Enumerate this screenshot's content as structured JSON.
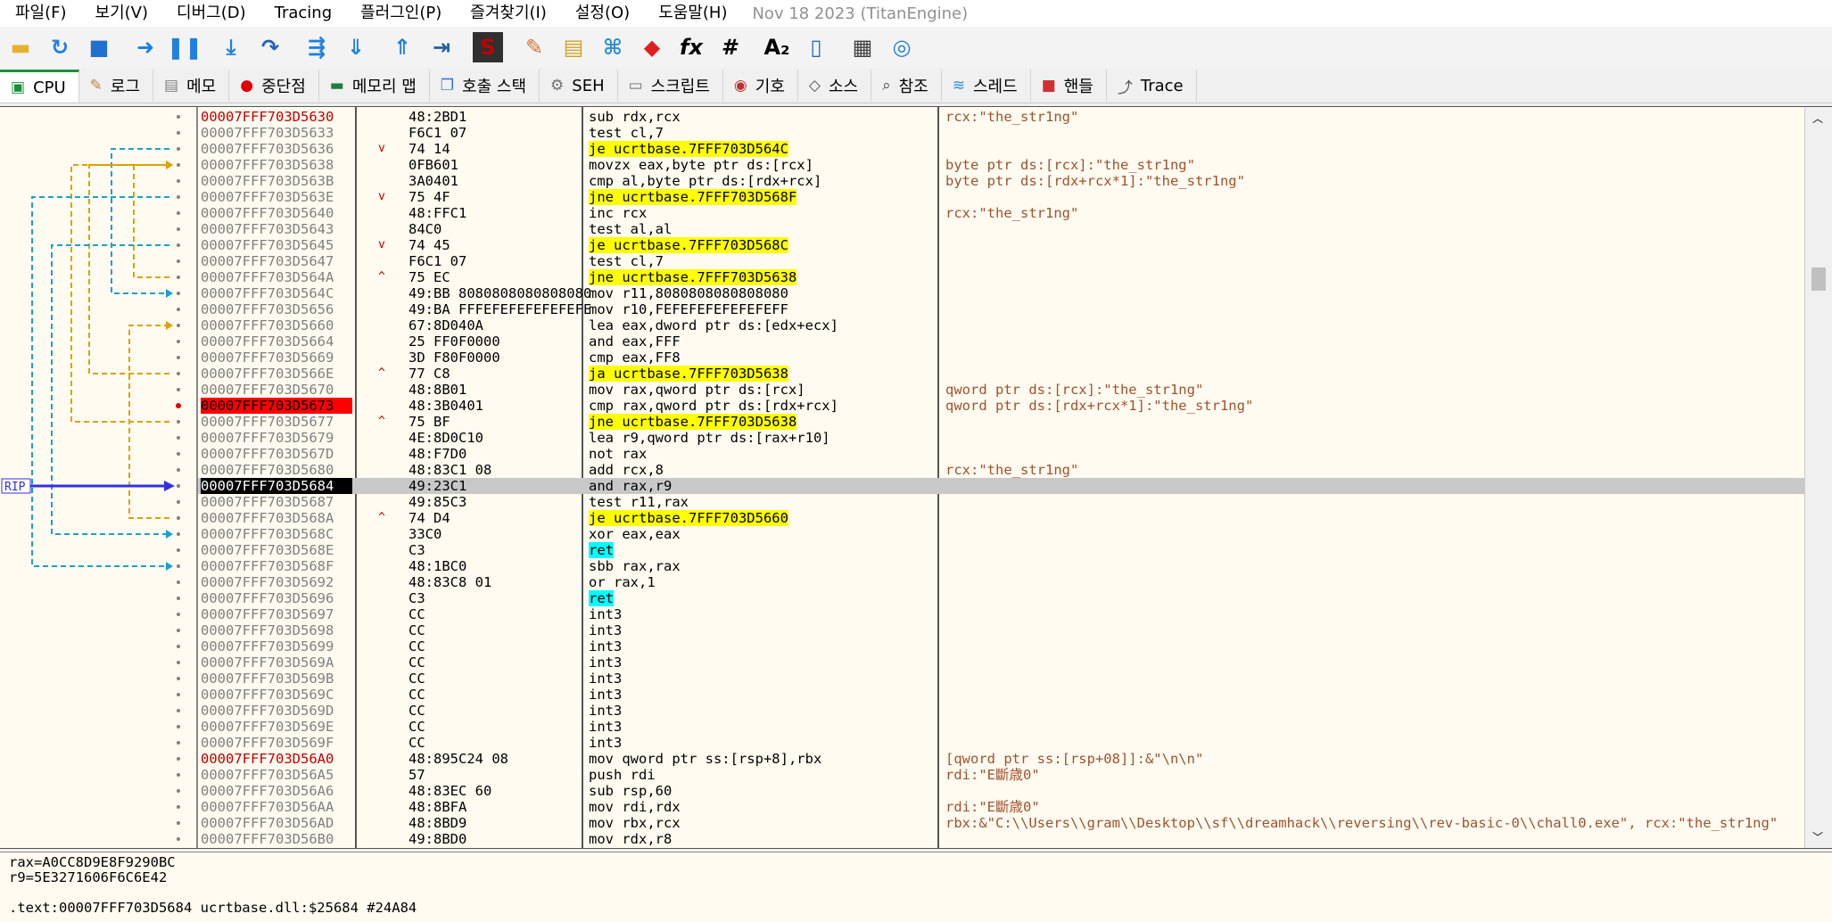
{
  "menu": [
    "파일(F)",
    "보기(V)",
    "디버그(D)",
    "Tracing",
    "플러그인(P)",
    "즐겨찾기(I)",
    "설정(O)",
    "도움말(H)"
  ],
  "build_date": "Nov 18 2023 (TitanEngine)",
  "toolbar_icons": [
    "open-icon",
    "restart-icon",
    "stop-icon",
    "run-icon",
    "pause-icon",
    "step-into-icon",
    "step-over-icon",
    "trace-into-icon",
    "trace-over-icon",
    "execute-till-return-icon",
    "run-to-user-code-icon",
    "scylla-icon",
    "patch-icon",
    "comment-icon",
    "label-icon",
    "bookmark-icon",
    "function-icon",
    "hash-icon",
    "font-icon",
    "sysinfo-icon",
    "calculator-icon",
    "web-icon"
  ],
  "tabs": [
    {
      "label": "CPU",
      "icon": "cpu-icon"
    },
    {
      "label": "로그",
      "icon": "log-icon"
    },
    {
      "label": "메모",
      "icon": "notes-icon"
    },
    {
      "label": "중단점",
      "icon": "breakpoint-icon"
    },
    {
      "label": "메모리 맵",
      "icon": "memory-map-icon"
    },
    {
      "label": "호출 스택",
      "icon": "call-stack-icon"
    },
    {
      "label": "SEH",
      "icon": "seh-icon"
    },
    {
      "label": "스크립트",
      "icon": "script-icon"
    },
    {
      "label": "기호",
      "icon": "symbols-icon"
    },
    {
      "label": "소스",
      "icon": "source-icon"
    },
    {
      "label": "참조",
      "icon": "references-icon"
    },
    {
      "label": "스레드",
      "icon": "threads-icon"
    },
    {
      "label": "핸들",
      "icon": "handles-icon"
    },
    {
      "label": "Trace",
      "icon": "trace-icon"
    }
  ],
  "rip_label": "RIP",
  "rows": [
    {
      "addr": "00007FFF703D5630",
      "bytes": "48:2BD1",
      "dis": "sub rdx,rcx",
      "cmt": "rcx:\"the_str1ng\"",
      "lbl": true
    },
    {
      "addr": "00007FFF703D5633",
      "bytes": "F6C1 07",
      "dis": "test cl,7",
      "cmt": ""
    },
    {
      "addr": "00007FFF703D5636",
      "bytes": "74 14",
      "dis": "je ucrtbase.7FFF703D564C",
      "cmt": "",
      "jmp": true
    },
    {
      "addr": "00007FFF703D5638",
      "bytes": "0FB601",
      "dis": "movzx eax,byte ptr ds:[rcx]",
      "cmt": "byte ptr ds:[rcx]:\"the_str1ng\""
    },
    {
      "addr": "00007FFF703D563B",
      "bytes": "3A0401",
      "dis": "cmp al,byte ptr ds:[rdx+rcx]",
      "cmt": "byte ptr ds:[rdx+rcx*1]:\"the_str1ng\""
    },
    {
      "addr": "00007FFF703D563E",
      "bytes": "75 4F",
      "dis": "jne ucrtbase.7FFF703D568F",
      "cmt": "",
      "jmp": true
    },
    {
      "addr": "00007FFF703D5640",
      "bytes": "48:FFC1",
      "dis": "inc rcx",
      "cmt": "rcx:\"the_str1ng\""
    },
    {
      "addr": "00007FFF703D5643",
      "bytes": "84C0",
      "dis": "test al,al",
      "cmt": ""
    },
    {
      "addr": "00007FFF703D5645",
      "bytes": "74 45",
      "dis": "je ucrtbase.7FFF703D568C",
      "cmt": "",
      "jmp": true
    },
    {
      "addr": "00007FFF703D5647",
      "bytes": "F6C1 07",
      "dis": "test cl,7",
      "cmt": ""
    },
    {
      "addr": "00007FFF703D564A",
      "bytes": "75 EC",
      "dis": "jne ucrtbase.7FFF703D5638",
      "cmt": "",
      "jmp": true,
      "up": true
    },
    {
      "addr": "00007FFF703D564C",
      "bytes": "49:BB 8080808080808080",
      "dis": "mov r11,8080808080808080",
      "cmt": ""
    },
    {
      "addr": "00007FFF703D5656",
      "bytes": "49:BA FFFEFEFEFEFEFEFE",
      "dis": "mov r10,FEFEFEFEFEFEFEFF",
      "cmt": ""
    },
    {
      "addr": "00007FFF703D5660",
      "bytes": "67:8D040A",
      "dis": "lea eax,dword ptr ds:[edx+ecx]",
      "cmt": ""
    },
    {
      "addr": "00007FFF703D5664",
      "bytes": "25 FF0F0000",
      "dis": "and eax,FFF",
      "cmt": ""
    },
    {
      "addr": "00007FFF703D5669",
      "bytes": "3D F80F0000",
      "dis": "cmp eax,FF8",
      "cmt": ""
    },
    {
      "addr": "00007FFF703D566E",
      "bytes": "77 C8",
      "dis": "ja ucrtbase.7FFF703D5638",
      "cmt": "",
      "jmp": true,
      "up": true
    },
    {
      "addr": "00007FFF703D5670",
      "bytes": "48:8B01",
      "dis": "mov rax,qword ptr ds:[rcx]",
      "cmt": "qword ptr ds:[rcx]:\"the_str1ng\""
    },
    {
      "addr": "00007FFF703D5673",
      "bytes": "48:3B0401",
      "dis": "cmp rax,qword ptr ds:[rdx+rcx]",
      "cmt": "qword ptr ds:[rdx+rcx*1]:\"the_str1ng\"",
      "bp": true
    },
    {
      "addr": "00007FFF703D5677",
      "bytes": "75 BF",
      "dis": "jne ucrtbase.7FFF703D5638",
      "cmt": "",
      "jmp": true,
      "up": true
    },
    {
      "addr": "00007FFF703D5679",
      "bytes": "4E:8D0C10",
      "dis": "lea r9,qword ptr ds:[rax+r10]",
      "cmt": ""
    },
    {
      "addr": "00007FFF703D567D",
      "bytes": "48:F7D0",
      "dis": "not rax",
      "cmt": ""
    },
    {
      "addr": "00007FFF703D5680",
      "bytes": "48:83C1 08",
      "dis": "add rcx,8",
      "cmt": "rcx:\"the_str1ng\""
    },
    {
      "addr": "00007FFF703D5684",
      "bytes": "49:23C1",
      "dis": "and rax,r9",
      "cmt": "",
      "rip": true
    },
    {
      "addr": "00007FFF703D5687",
      "bytes": "49:85C3",
      "dis": "test r11,rax",
      "cmt": ""
    },
    {
      "addr": "00007FFF703D568A",
      "bytes": "74 D4",
      "dis": "je ucrtbase.7FFF703D5660",
      "cmt": "",
      "jmp": true,
      "up": true
    },
    {
      "addr": "00007FFF703D568C",
      "bytes": "33C0",
      "dis": "xor eax,eax",
      "cmt": ""
    },
    {
      "addr": "00007FFF703D568E",
      "bytes": "C3",
      "dis": "ret",
      "cmt": "",
      "ret": true
    },
    {
      "addr": "00007FFF703D568F",
      "bytes": "48:1BC0",
      "dis": "sbb rax,rax",
      "cmt": ""
    },
    {
      "addr": "00007FFF703D5692",
      "bytes": "48:83C8 01",
      "dis": "or rax,1",
      "cmt": ""
    },
    {
      "addr": "00007FFF703D5696",
      "bytes": "C3",
      "dis": "ret",
      "cmt": "",
      "ret": true
    },
    {
      "addr": "00007FFF703D5697",
      "bytes": "CC",
      "dis": "int3",
      "cmt": ""
    },
    {
      "addr": "00007FFF703D5698",
      "bytes": "CC",
      "dis": "int3",
      "cmt": ""
    },
    {
      "addr": "00007FFF703D5699",
      "bytes": "CC",
      "dis": "int3",
      "cmt": ""
    },
    {
      "addr": "00007FFF703D569A",
      "bytes": "CC",
      "dis": "int3",
      "cmt": ""
    },
    {
      "addr": "00007FFF703D569B",
      "bytes": "CC",
      "dis": "int3",
      "cmt": ""
    },
    {
      "addr": "00007FFF703D569C",
      "bytes": "CC",
      "dis": "int3",
      "cmt": ""
    },
    {
      "addr": "00007FFF703D569D",
      "bytes": "CC",
      "dis": "int3",
      "cmt": ""
    },
    {
      "addr": "00007FFF703D569E",
      "bytes": "CC",
      "dis": "int3",
      "cmt": ""
    },
    {
      "addr": "00007FFF703D569F",
      "bytes": "CC",
      "dis": "int3",
      "cmt": ""
    },
    {
      "addr": "00007FFF703D56A0",
      "bytes": "48:895C24 08",
      "dis": "mov qword ptr ss:[rsp+8],rbx",
      "cmt": "[qword ptr ss:[rsp+08]]:&\"\\n\\n\"",
      "lbl": true
    },
    {
      "addr": "00007FFF703D56A5",
      "bytes": "57",
      "dis": "push rdi",
      "cmt": "rdi:\"E斷歳0\""
    },
    {
      "addr": "00007FFF703D56A6",
      "bytes": "48:83EC 60",
      "dis": "sub rsp,60",
      "cmt": ""
    },
    {
      "addr": "00007FFF703D56AA",
      "bytes": "48:8BFA",
      "dis": "mov rdi,rdx",
      "cmt": "rdi:\"E斷歳0\""
    },
    {
      "addr": "00007FFF703D56AD",
      "bytes": "48:8BD9",
      "dis": "mov rbx,rcx",
      "cmt": "rbx:&\"C:\\\\Users\\\\gram\\\\Desktop\\\\sf\\\\dreamhack\\\\reversing\\\\rev-basic-0\\\\chall0.exe\", rcx:\"the_str1ng\""
    },
    {
      "addr": "00007FFF703D56B0",
      "bytes": "49:8BD0",
      "dis": "mov rdx,r8",
      "cmt": ""
    }
  ],
  "info": {
    "line1": "rax=A0CC8D9E8F9290BC",
    "line2": "r9=5E3271606F6C6E42",
    "line3": ".text:00007FFF703D5684 ucrtbase.dll:$25684 #24A84"
  },
  "colors": {
    "label_addr": "#c00000",
    "breakpoint_bg": "#ff0000",
    "rip_bg": "#000000",
    "highlight": "#ffff00",
    "ret_highlight": "#00ffff",
    "comment": "#a0522d",
    "arrow_orange": "#e0a000",
    "arrow_cyan": "#1aa0d0",
    "rip_arrow": "#3030e0"
  }
}
